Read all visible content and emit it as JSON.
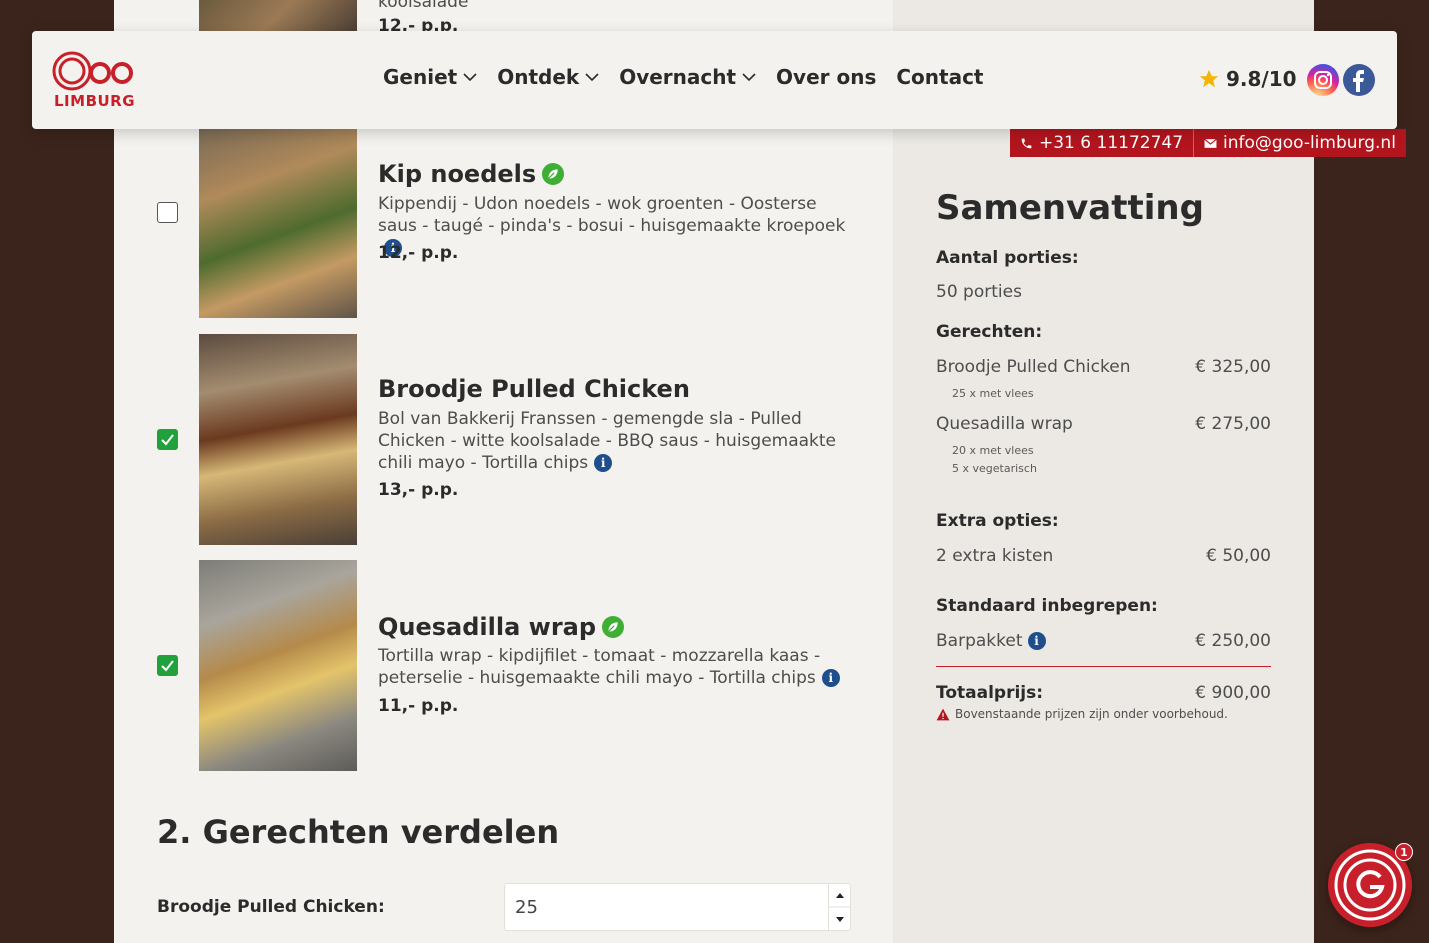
{
  "header": {
    "logo_text": "LIMBURG",
    "logo_wordmark": "GOO",
    "nav": [
      {
        "label": "Geniet",
        "dropdown": true
      },
      {
        "label": "Ontdek",
        "dropdown": true
      },
      {
        "label": "Overnacht",
        "dropdown": true
      },
      {
        "label": "Over ons",
        "dropdown": false
      },
      {
        "label": "Contact",
        "dropdown": false
      }
    ],
    "rating": "9.8/10",
    "phone": "+31 6 11172747",
    "email": "info@goo-limburg.nl"
  },
  "colors": {
    "brand_red": "#c8202b",
    "page_bg": "#3b241b",
    "checkbox_green": "#22a03c",
    "info_blue": "#1e4e8c"
  },
  "dishes_partial_top": {
    "desc_tail": "koolsalade",
    "price": "12,- p.p."
  },
  "dishes": [
    {
      "title": "Kip noedels",
      "vegan_icon": true,
      "checked": false,
      "description": "Kippendij - Udon noedels - wok groenten - Oosterse saus - taugé - pinda's - bosui - huisgemaakte kroepoek",
      "price": "12,- p.p."
    },
    {
      "title": "Broodje Pulled Chicken",
      "vegan_icon": false,
      "checked": true,
      "description": "Bol van Bakkerij Franssen - gemengde sla - Pulled Chicken - witte koolsalade - BBQ saus - huisgemaakte chili mayo - Tortilla chips",
      "price": "13,- p.p."
    },
    {
      "title": "Quesadilla wrap",
      "vegan_icon": true,
      "checked": true,
      "description": "Tortilla wrap - kipdijfilet - tomaat - mozzarella kaas - peterselie - huisgemaakte chili mayo - Tortilla chips",
      "price": "11,- p.p."
    }
  ],
  "distribute": {
    "title": "2. Gerechten verdelen",
    "label": "Broodje Pulled Chicken:",
    "value": "25"
  },
  "summary": {
    "title": "Samenvatting",
    "portions_heading": "Aantal porties:",
    "portions_value": "50 porties",
    "dishes_heading": "Gerechten:",
    "dish_lines": [
      {
        "name": "Broodje Pulled Chicken",
        "price": "€ 325,00",
        "subs": [
          "25 x met vlees"
        ]
      },
      {
        "name": "Quesadilla wrap",
        "price": "€ 275,00",
        "subs": [
          "20 x met vlees",
          "5 x vegetarisch"
        ]
      }
    ],
    "extra_heading": "Extra opties:",
    "extra_name": "2 extra kisten",
    "extra_price": "€ 50,00",
    "standard_heading": "Standaard inbegrepen:",
    "standard_name": "Barpakket",
    "standard_price": "€ 250,00",
    "total_label": "Totaalprijs:",
    "total_value": "€ 900,00",
    "disclaimer": "Bovenstaande prijzen zijn onder voorbehoud."
  },
  "chat": {
    "badge": "1"
  }
}
